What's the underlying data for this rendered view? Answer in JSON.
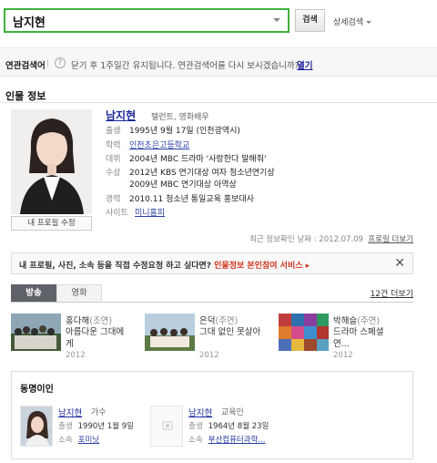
{
  "search": {
    "query": "남지현",
    "button": "검색",
    "detail": "상세검색"
  },
  "related": {
    "label": "연관검색어",
    "info_icon": "?",
    "message": "닫기 후 1주일간 유지됩니다. 연관검색어를 다시 보시겠습니까?",
    "open": "열기"
  },
  "section_title": "인물 정보",
  "profile": {
    "name": "남지현",
    "job": "탤런트, 영화배우",
    "edit_button": "내 프로필 수정",
    "rows": [
      {
        "key": "출생",
        "value": "1995년 9월 17일 (인천광역시)"
      },
      {
        "key": "학력",
        "value": "인천초은고등학교"
      },
      {
        "key": "데뷔",
        "value": "2004년 MBC 드라마 '사랑한다 말해줘'"
      },
      {
        "key": "수상",
        "value": "2012년 KBS 연기대상 여자 청소년연기상"
      },
      {
        "key": "",
        "value": "2009년 MBC 연기대상 아역상"
      },
      {
        "key": "경력",
        "value": "2010.11 청소년 통일교육 홍보대사"
      },
      {
        "key": "사이트",
        "value": "미니홈피"
      }
    ],
    "updated_label": "최근 정보확인 날짜 : 2012.07.09",
    "report_link": "프로필 더보기"
  },
  "banner": {
    "text": "내 프로필, 사진, 소속 등을 직접 수정요청 하고 싶다면?",
    "service": "인물정보 본인참여 서비스 ▸",
    "close": "✕"
  },
  "tabs": [
    {
      "label": "방송"
    },
    {
      "label": "영화"
    }
  ],
  "more_works": "12건 더보기",
  "works": [
    {
      "role": "홍다해",
      "role_type": "(조연)",
      "title": "아름다운 그대에게",
      "year": "2012"
    },
    {
      "role": "은덕",
      "role_type": "(주연)",
      "title": "그대 없인 못살아",
      "year": "2012"
    },
    {
      "role": "박해슬",
      "role_type": "(주연)",
      "title": "드라마 스페셜 연...",
      "year": "2012"
    }
  ],
  "same_name": {
    "title": "동명이인",
    "people": [
      {
        "name": "남지현",
        "job": "가수",
        "row1_key": "출생",
        "row1": "1990년 1월 9일",
        "row2_key": "소속",
        "row2": "포미닛"
      },
      {
        "name": "남지현",
        "job": "교육인",
        "row1_key": "출생",
        "row1": "1964년 8월 23일",
        "row2_key": "소속",
        "row2": "부산컴퓨터과학..."
      }
    ]
  },
  "colors": {
    "search_border": "#3eb23e",
    "link": "#2a3fa8",
    "accent_red": "#d03820",
    "tab_active": "#5f6268"
  }
}
